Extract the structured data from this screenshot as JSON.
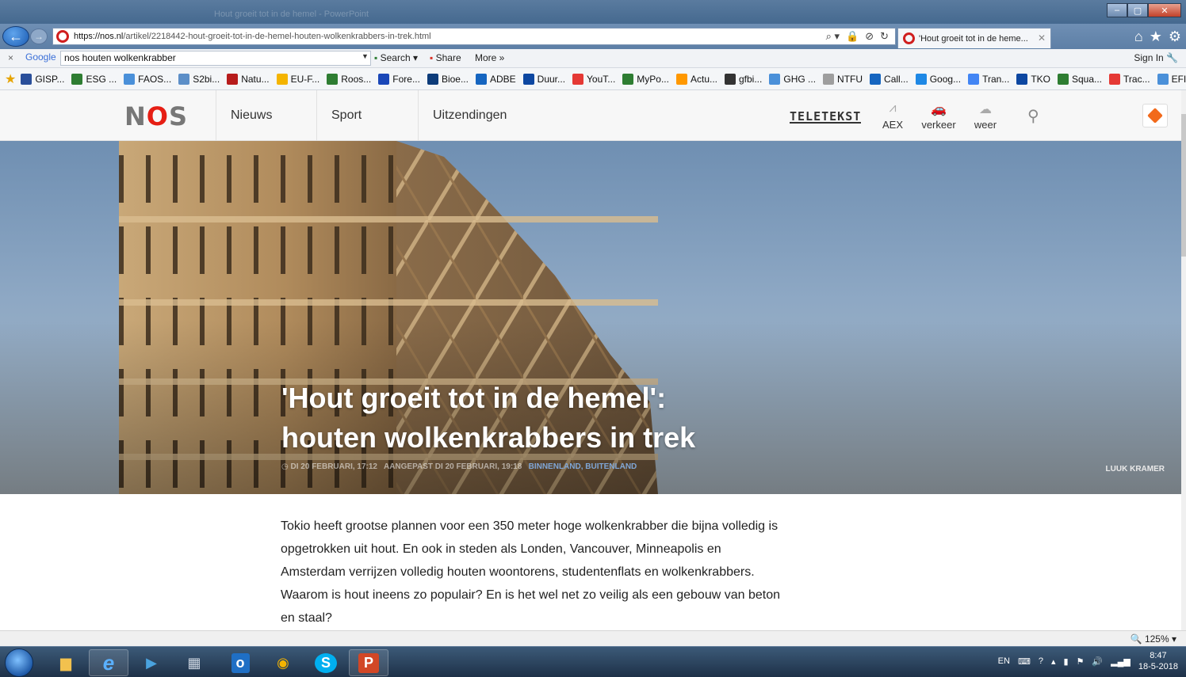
{
  "browser": {
    "url_host": "https://nos.nl",
    "url_path": "/artikel/2218442-hout-groeit-tot-in-de-hemel-houten-wolkenkrabbers-in-trek.html",
    "tab_title": "'Hout groeit tot in de heme...",
    "window_ghost_title": "Hout groeit tot in de hemel - PowerPoint"
  },
  "google_toolbar": {
    "close": "×",
    "logo": "Google",
    "query": "nos houten wolkenkrabber",
    "search_label": "Search",
    "share_label": "Share",
    "more_label": "More »",
    "sign_in": "Sign In"
  },
  "favorites": [
    {
      "label": "GISP...",
      "color": "#2a4f9a"
    },
    {
      "label": "ESG ...",
      "color": "#2e7d32"
    },
    {
      "label": "FAOS...",
      "color": "#4a90d9"
    },
    {
      "label": "S2bi...",
      "color": "#5c8fc8"
    },
    {
      "label": "Natu...",
      "color": "#b71c1c"
    },
    {
      "label": "EU-F...",
      "color": "#f4b400"
    },
    {
      "label": "Roos...",
      "color": "#2e7d32"
    },
    {
      "label": "Fore...",
      "color": "#1a47b8"
    },
    {
      "label": "Bioe...",
      "color": "#0d3c7a"
    },
    {
      "label": "ADBE",
      "color": "#1565c0"
    },
    {
      "label": "Duur...",
      "color": "#0d47a1"
    },
    {
      "label": "YouT...",
      "color": "#e53935"
    },
    {
      "label": "MyPo...",
      "color": "#2e7d32"
    },
    {
      "label": "Actu...",
      "color": "#ff9800"
    },
    {
      "label": "gfbi...",
      "color": "#333333"
    },
    {
      "label": "GHG ...",
      "color": "#4a90d9"
    },
    {
      "label": "NTFU",
      "color": "#9e9e9e"
    },
    {
      "label": "Call...",
      "color": "#1565c0"
    },
    {
      "label": "Goog...",
      "color": "#1e88e5"
    },
    {
      "label": "Tran...",
      "color": "#4285f4"
    },
    {
      "label": "TKO",
      "color": "#0d47a1"
    },
    {
      "label": "Squa...",
      "color": "#2e7d32"
    },
    {
      "label": "Trac...",
      "color": "#e53935"
    },
    {
      "label": "EFI",
      "color": "#4a90d9"
    }
  ],
  "nos": {
    "logo_left": "N",
    "logo_o": "O",
    "logo_right": "S",
    "nav": [
      "Nieuws",
      "Sport",
      "Uitzendingen"
    ],
    "teletekst": "TELETEKST",
    "tools": [
      {
        "label": "AEX",
        "icon": "chart-icon"
      },
      {
        "label": "verkeer",
        "icon": "car-icon"
      },
      {
        "label": "weer",
        "icon": "cloud-icon"
      }
    ]
  },
  "article": {
    "title_line1": "'Hout groeit tot in de hemel':",
    "title_line2": "houten wolkenkrabbers in trek",
    "date": "DI 20 FEBRUARI, 17:12",
    "updated": "AANGEPAST DI 20 FEBRUARI, 19:18",
    "tags": "BINNENLAND, BUITENLAND",
    "photo_credit": "LUUK KRAMER",
    "lead": "Tokio heeft grootse plannen voor een 350 meter hoge wolkenkrabber die bijna volledig is opgetrokken uit hout. En ook in steden als Londen, Vancouver, Minneapolis en Amsterdam verrijzen volledig houten woontorens, studentenflats en wolkenkrabbers. Waarom is hout ineens zo populair? En is het wel net zo veilig als een gebouw van beton en staal?"
  },
  "statusbar": {
    "zoom": "125%"
  },
  "taskbar": {
    "language": "EN",
    "time": "8:47",
    "date": "18-5-2018"
  }
}
